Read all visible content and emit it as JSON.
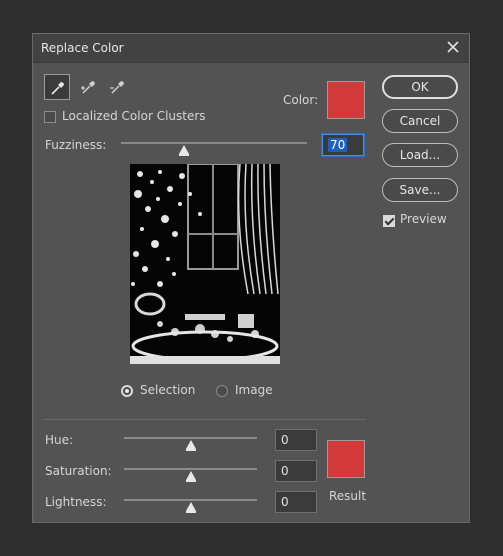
{
  "dialog": {
    "title": "Replace Color"
  },
  "tools": [
    {
      "name": "eyedropper"
    },
    {
      "name": "eyedropper-add"
    },
    {
      "name": "eyedropper-subtract"
    }
  ],
  "options": {
    "localized_label": "Localized Color Clusters",
    "localized_checked": false
  },
  "color": {
    "label": "Color:",
    "hex": "#d23a3a"
  },
  "fuzziness": {
    "label": "Fuzziness:",
    "value": "70",
    "slider_fraction": 0.35
  },
  "view": {
    "selection_label": "Selection",
    "image_label": "Image",
    "selected": "selection"
  },
  "buttons": {
    "ok": "OK",
    "cancel": "Cancel",
    "load": "Load...",
    "save": "Save..."
  },
  "preview_option": {
    "label": "Preview",
    "checked": true
  },
  "adjust": {
    "hue": {
      "label": "Hue:",
      "value": "0"
    },
    "saturation": {
      "label": "Saturation:",
      "value": "0"
    },
    "lightness": {
      "label": "Lightness:",
      "value": "0"
    }
  },
  "result": {
    "label": "Result",
    "hex": "#d23a3a"
  }
}
